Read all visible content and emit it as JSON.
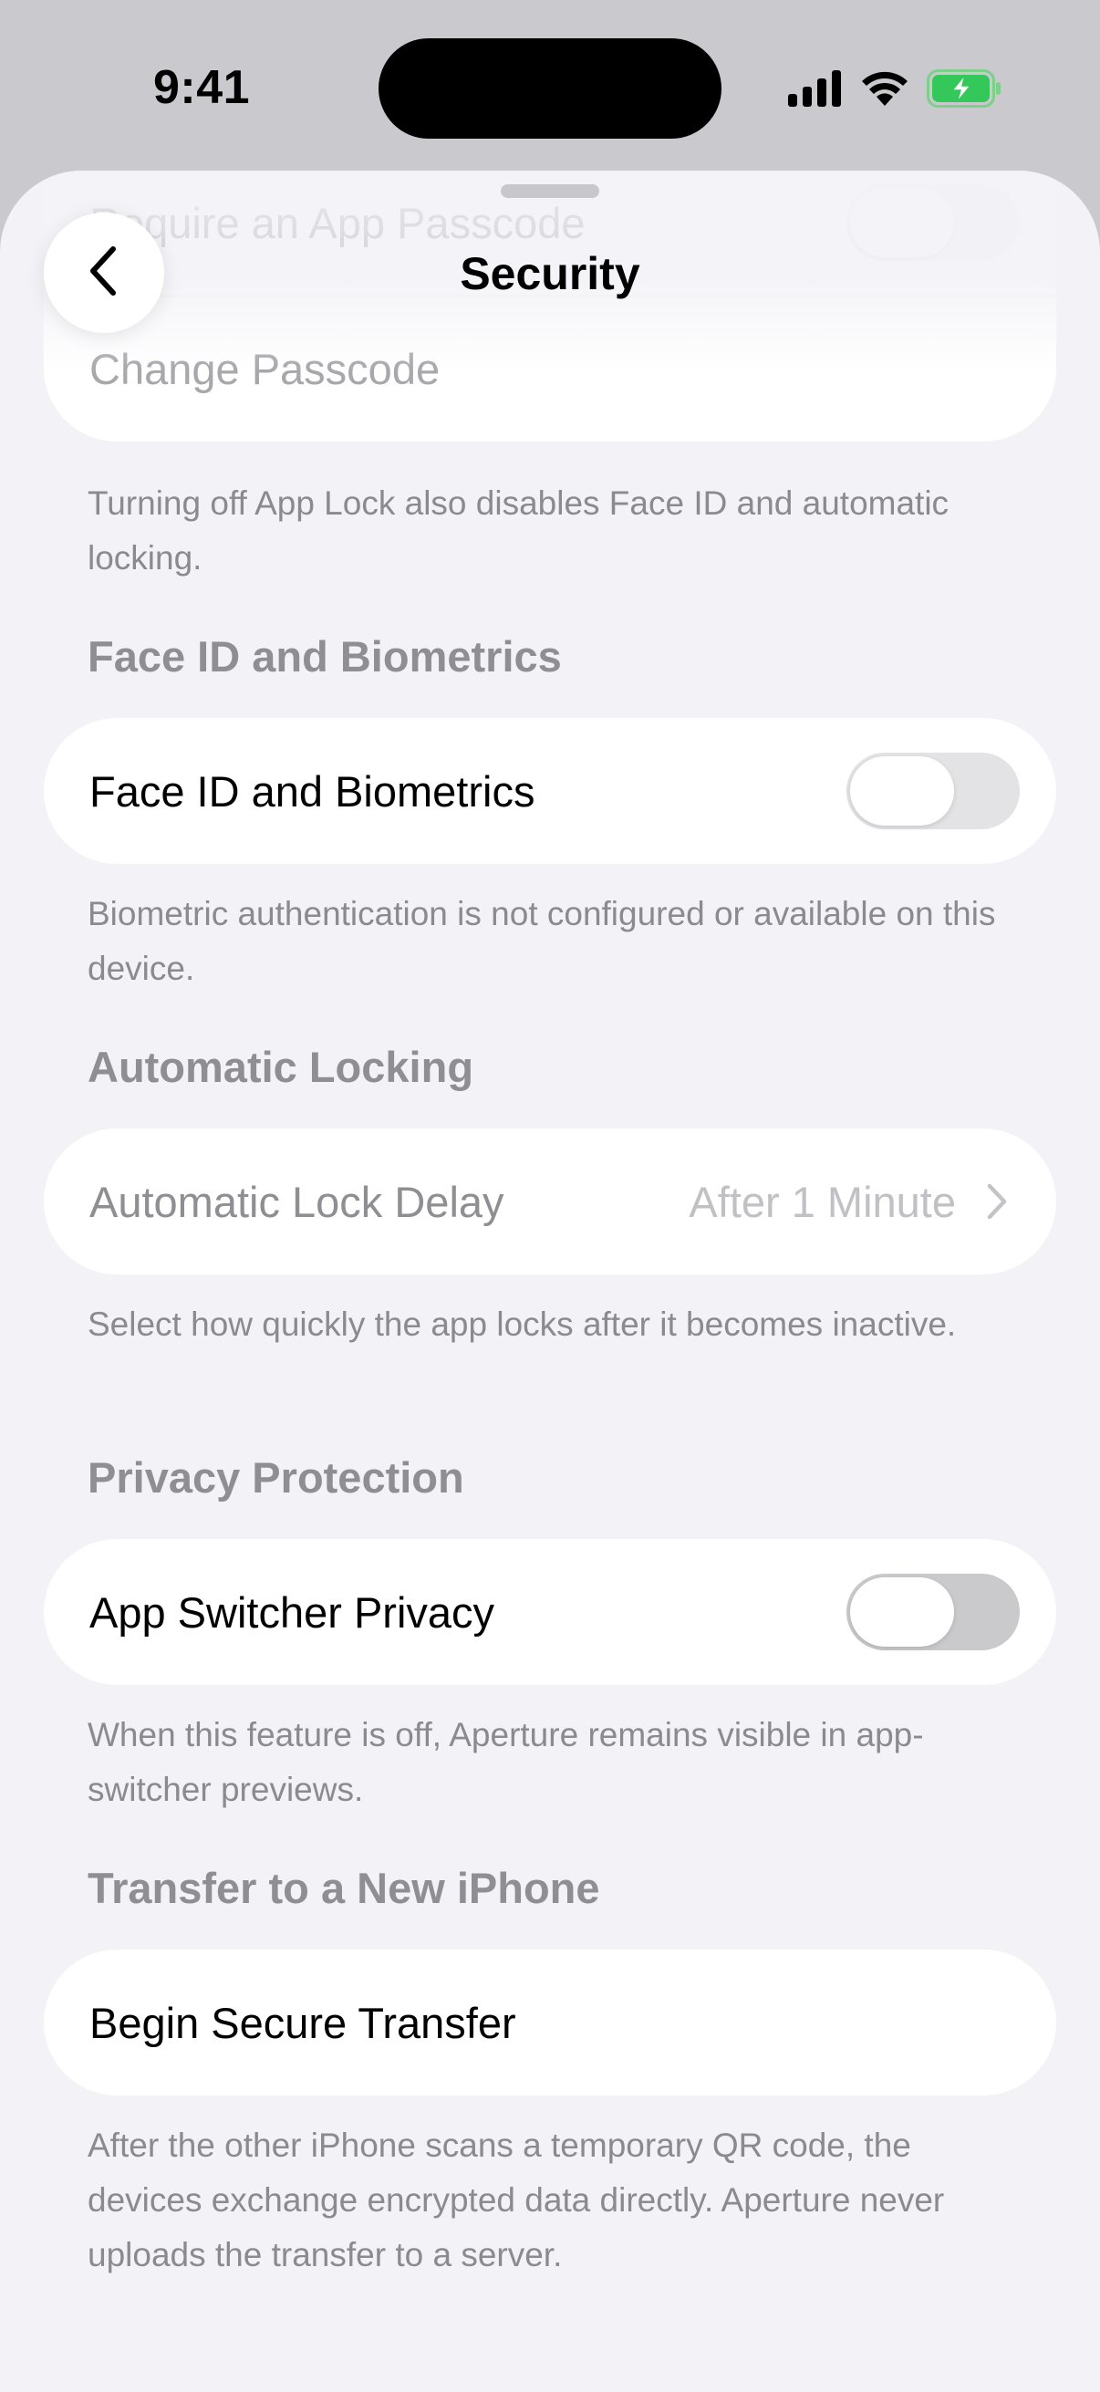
{
  "status_bar": {
    "time": "9:41",
    "icons": [
      "cellular-signal-icon",
      "wifi-icon",
      "battery-charging-icon"
    ],
    "battery_color": "#34c759"
  },
  "nav": {
    "title": "Security",
    "back_icon": "chevron-left-icon"
  },
  "app_lock": {
    "require_passcode_label": "Require an App Passcode",
    "change_passcode_label": "Change Passcode",
    "footer": "Turning off App Lock also disables Face ID and automatic locking."
  },
  "face_id": {
    "header": "Face ID and Biometrics",
    "label": "Face ID and Biometrics",
    "enabled": false,
    "footer": "Biometric authentication is not configured or available on this device."
  },
  "auto_lock": {
    "header": "Automatic Locking",
    "label": "Automatic Lock Delay",
    "value": "After 1 Minute",
    "footer": "Select how quickly the app locks after it becomes inactive."
  },
  "privacy": {
    "header": "Privacy Protection",
    "label": "App Switcher Privacy",
    "enabled": false,
    "footer": "When this feature is off, Aperture remains visible in app-switcher previews."
  },
  "transfer": {
    "header": "Transfer to a New iPhone",
    "label": "Begin Secure Transfer",
    "footer": "After the other iPhone scans a temporary QR code, the devices exchange encrypted data directly. Aperture never uploads the transfer to a server."
  }
}
